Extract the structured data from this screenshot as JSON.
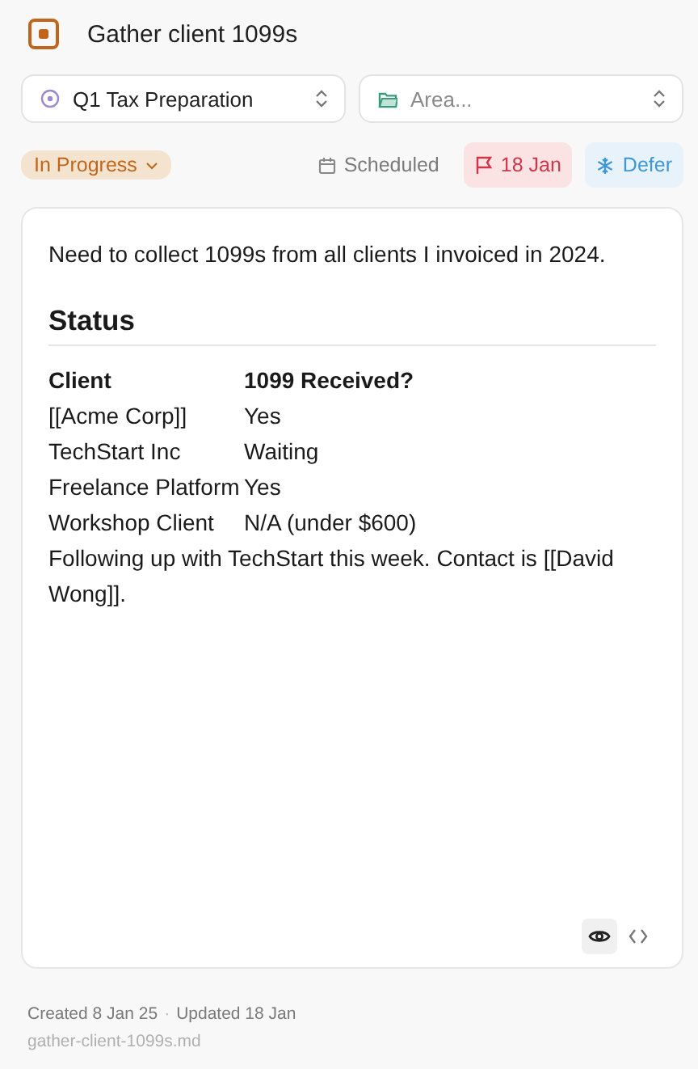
{
  "task": {
    "title": "Gather client 1099s",
    "kind": "in_progress"
  },
  "project": {
    "value": "Q1 Tax Preparation"
  },
  "area": {
    "placeholder": "Area..."
  },
  "status": {
    "label": "In Progress"
  },
  "dates": [
    {
      "kind": "scheduled",
      "label": "Scheduled"
    },
    {
      "kind": "deadline",
      "label": "18 Jan"
    },
    {
      "kind": "defer",
      "label": "Defer"
    }
  ],
  "note": {
    "intro": "Need to collect 1099s from all clients I invoiced in 2024.",
    "heading": "Status",
    "table": {
      "columns": [
        "Client",
        "1099 Received?"
      ],
      "rows": [
        [
          "[[Acme Corp]]",
          "Yes"
        ],
        [
          "TechStart Inc",
          "Waiting"
        ],
        [
          "Freelance Platform",
          "Yes"
        ],
        [
          "Workshop Client",
          "N/A (under $600)"
        ]
      ]
    },
    "outro": "Following up with TechStart this week. Contact is [[David Wong]]."
  },
  "view_modes": [
    {
      "kind": "preview",
      "selected": true
    },
    {
      "kind": "source",
      "selected": false
    }
  ],
  "footer": {
    "created": "Created 8 Jan 25",
    "separator": "·",
    "updated": "Updated 18 Jan",
    "filename": "gather-client-1099s.md"
  }
}
